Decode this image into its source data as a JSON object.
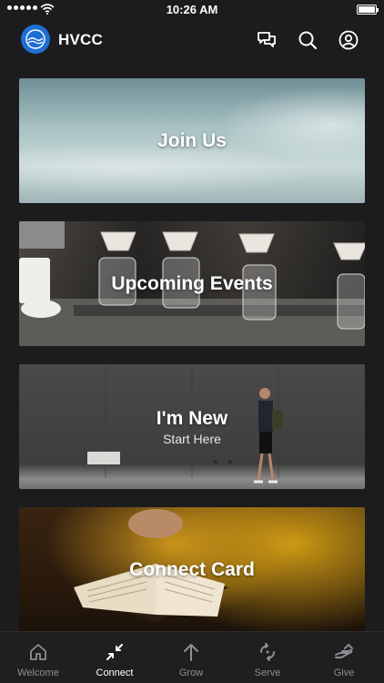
{
  "status": {
    "time": "10:26 AM",
    "battery_level": 1.0
  },
  "header": {
    "title": "HVCC",
    "icons": [
      "chat-icon",
      "search-icon",
      "profile-icon"
    ]
  },
  "cards": [
    {
      "title": "Join Us",
      "subtitle": ""
    },
    {
      "title": "Upcoming Events",
      "subtitle": ""
    },
    {
      "title": "I'm New",
      "subtitle": "Start Here"
    },
    {
      "title": "Connect Card",
      "subtitle": ""
    }
  ],
  "tabs": [
    {
      "label": "Welcome",
      "icon": "home-icon",
      "active": false
    },
    {
      "label": "Connect",
      "icon": "connect-icon",
      "active": true
    },
    {
      "label": "Grow",
      "icon": "arrow-up-icon",
      "active": false
    },
    {
      "label": "Serve",
      "icon": "serve-icon",
      "active": false
    },
    {
      "label": "Give",
      "icon": "give-icon",
      "active": false
    }
  ],
  "colors": {
    "background": "#1c1c1e",
    "accent": "#1f6ed4",
    "inactive": "#8e8e93"
  }
}
